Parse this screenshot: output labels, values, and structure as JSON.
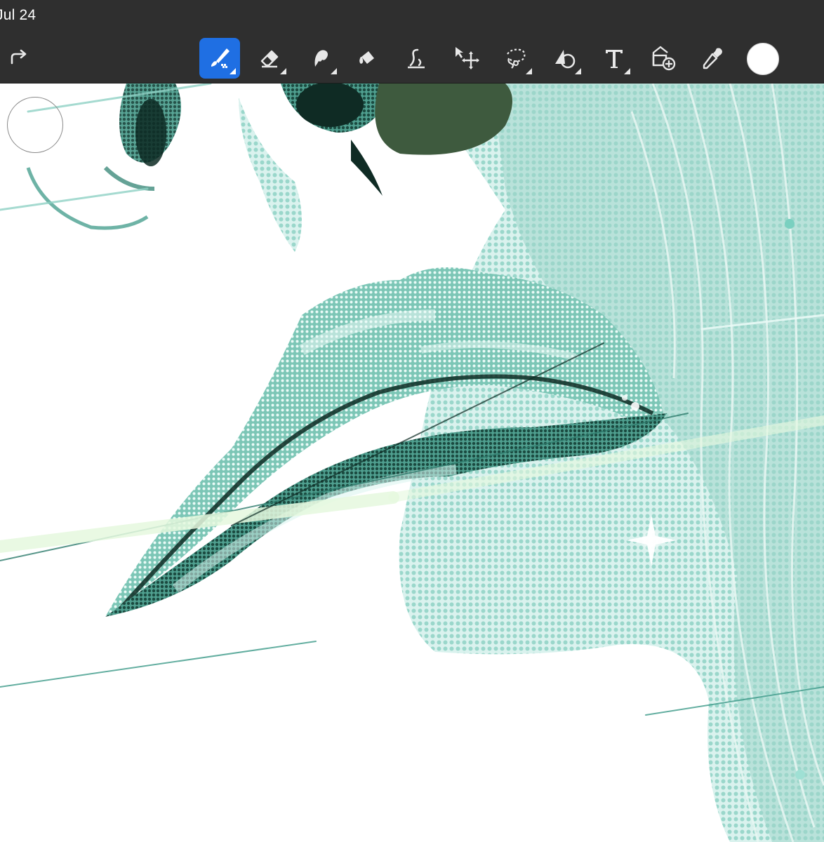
{
  "status_bar": {
    "date": "Jul 24"
  },
  "toolbar": {
    "redo_icon": "redo-arrow-icon",
    "tools": [
      {
        "name": "paint",
        "icon": "paintbrush-icon",
        "active": true
      },
      {
        "name": "erase",
        "icon": "eraser-icon",
        "active": false
      },
      {
        "name": "smudge",
        "icon": "smudge-icon",
        "active": false
      },
      {
        "name": "fill",
        "icon": "paint-bucket-icon",
        "active": false
      },
      {
        "name": "liquify",
        "icon": "liquify-icon",
        "active": false
      },
      {
        "name": "transform",
        "icon": "move-arrows-icon",
        "active": false
      },
      {
        "name": "selection",
        "icon": "lasso-icon",
        "active": false
      },
      {
        "name": "shape",
        "icon": "shape-icon",
        "active": false
      },
      {
        "name": "text",
        "icon": "text-icon",
        "active": false
      },
      {
        "name": "import",
        "icon": "image-import-icon",
        "active": false
      },
      {
        "name": "eyedropper",
        "icon": "eyedropper-icon",
        "active": false
      }
    ],
    "current_color": "#ffffff"
  },
  "colors": {
    "toolbar_bg": "#2f2f2f",
    "accent": "#1f6fe3",
    "teal_light": "#a9dcd2",
    "teal_mid": "#5fb3a2",
    "teal_dark": "#1f4f45",
    "ink": "#0e2a24"
  }
}
